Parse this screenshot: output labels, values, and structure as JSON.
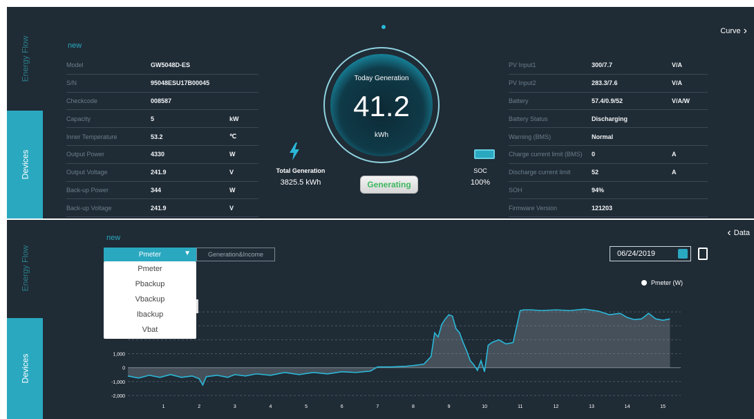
{
  "top": {
    "dot_color": "#2ab8d8",
    "side_tabs": {
      "energy_flow": "Energy Flow",
      "devices": "Devices"
    },
    "new_label": "new",
    "left_table": [
      {
        "label": "Model",
        "value": "GW5048D-ES",
        "unit": ""
      },
      {
        "label": "S/N",
        "value": "95048ESU17B00045",
        "unit": ""
      },
      {
        "label": "Checkcode",
        "value": "008587",
        "unit": ""
      },
      {
        "label": "Capacity",
        "value": "5",
        "unit": "kW"
      },
      {
        "label": "Inner Temperature",
        "value": "53.2",
        "unit": "℃"
      },
      {
        "label": "Output Power",
        "value": "4330",
        "unit": "W"
      },
      {
        "label": "Output Voltage",
        "value": "241.9",
        "unit": "V"
      },
      {
        "label": "Back-up Power",
        "value": "344",
        "unit": "W"
      },
      {
        "label": "Back-up Voltage",
        "value": "241.9",
        "unit": "V"
      }
    ],
    "right_table": [
      {
        "label": "PV Input1",
        "value": "300/7.7",
        "unit": "V/A"
      },
      {
        "label": "PV Input2",
        "value": "283.3/7.6",
        "unit": "V/A"
      },
      {
        "label": "Battery",
        "value": "57.4/0.9/52",
        "unit": "V/A/W"
      },
      {
        "label": "Battery Status",
        "value": "Discharging",
        "unit": ""
      },
      {
        "label": "Warning (BMS)",
        "value": "Normal",
        "unit": ""
      },
      {
        "label": "Charge current limit (BMS)",
        "value": "0",
        "unit": "A"
      },
      {
        "label": "Discharge current limit",
        "value": "52",
        "unit": "A"
      },
      {
        "label": "SOH",
        "value": "94%",
        "unit": ""
      },
      {
        "label": "Firmware Version",
        "value": "121203",
        "unit": ""
      }
    ],
    "gauge": {
      "title": "Today Generation",
      "value": "41.2",
      "unit": "kWh"
    },
    "total_generation": {
      "label": "Total Generation",
      "value": "3825.5 kWh"
    },
    "soc": {
      "label": "SOC",
      "value": "100%"
    },
    "status_button": "Generating",
    "curve_link": "Curve",
    "icons": {
      "lightning": "lightning-icon",
      "battery": "battery-icon",
      "chevron_right": "chevron-right-icon"
    }
  },
  "bottom": {
    "side_tabs": {
      "energy_flow": "Energy Flow",
      "devices": "Devices"
    },
    "new_label": "new",
    "data_link": "Data",
    "select": {
      "selected": "Pmeter",
      "options": [
        "Pmeter",
        "Pbackup",
        "Vbackup",
        "Ibackup",
        "Vbat"
      ]
    },
    "tab_generation_income": "Generation&Income",
    "date": "06/24/2019",
    "legend": "Pmeter  (W)"
  },
  "chart_data": {
    "type": "area",
    "series": [
      {
        "name": "Pmeter  (W)"
      }
    ],
    "x": [
      0.0,
      0.3,
      0.6,
      0.9,
      1.2,
      1.5,
      1.8,
      2.0,
      2.1,
      2.2,
      2.5,
      2.8,
      3.0,
      3.3,
      3.6,
      4.0,
      4.4,
      4.8,
      5.2,
      5.6,
      6.0,
      6.4,
      6.8,
      7.0,
      7.4,
      7.8,
      8.0,
      8.3,
      8.5,
      8.6,
      8.7,
      8.8,
      8.9,
      9.0,
      9.1,
      9.2,
      9.3,
      9.4,
      9.5,
      9.6,
      9.7,
      9.8,
      9.9,
      10.0,
      10.1,
      10.2,
      10.4,
      10.6,
      10.8,
      11.0,
      11.1,
      11.3,
      11.6,
      12.0,
      12.4,
      12.8,
      13.2,
      13.5,
      13.8,
      14.0,
      14.2,
      14.4,
      14.6,
      14.8,
      15.0,
      15.2
    ],
    "y": [
      -600,
      -750,
      -550,
      -700,
      -500,
      -700,
      -600,
      -800,
      -1250,
      -650,
      -550,
      -700,
      -500,
      -600,
      -450,
      -550,
      -350,
      -500,
      -350,
      -450,
      -300,
      -350,
      -250,
      50,
      50,
      100,
      150,
      250,
      800,
      2500,
      2200,
      3100,
      3500,
      3800,
      3700,
      2800,
      2500,
      1800,
      1200,
      500,
      200,
      -200,
      500,
      -300,
      1600,
      1800,
      2000,
      1700,
      1800,
      4100,
      4150,
      4150,
      4100,
      4150,
      4100,
      4200,
      4050,
      3800,
      3900,
      3600,
      3450,
      3500,
      3900,
      3500,
      3400,
      3500
    ],
    "xlim": [
      0,
      15.5
    ],
    "ylim": [
      -2200,
      5000
    ],
    "x_ticks": [
      1,
      2,
      3,
      4,
      5,
      6,
      7,
      8,
      9,
      10,
      11,
      12,
      13,
      14,
      15
    ],
    "y_ticks": [
      1000,
      0,
      -1000,
      -2000
    ],
    "y_tick_labels": [
      "1,000",
      "0",
      "-1,000",
      "-2,000"
    ],
    "grid": "horizontal dashed",
    "legend_position": "top-right",
    "line_color": "#2ab8d8"
  }
}
